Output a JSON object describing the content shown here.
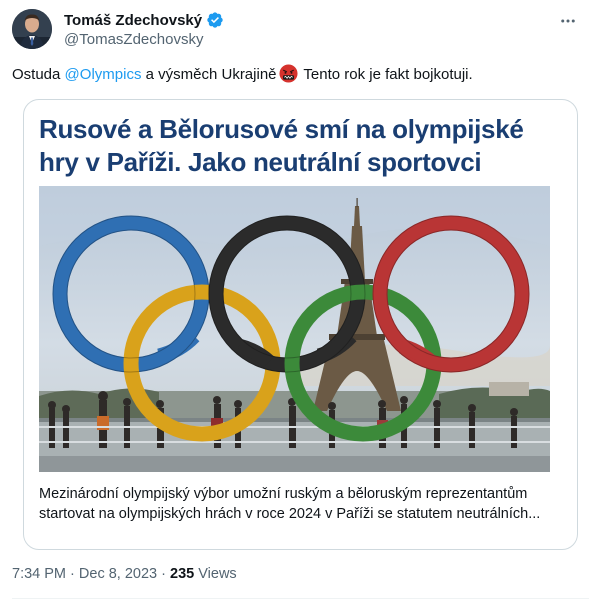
{
  "author": {
    "name": "Tomáš Zdechovský",
    "handle": "@TomasZdechovsky"
  },
  "tweet": {
    "text_before": "Ostuda",
    "mention": "@Olympics",
    "text_middle": "a výsměch Ukrajině",
    "emoji": "face-with-symbols-on-mouth",
    "text_after": "Tento rok je fakt bojkotuji."
  },
  "card": {
    "headline": "Rusové a Bělorusové smí na olympijské hry v Paříži. Jako neutrální sportovci",
    "description": "Mezinárodní olympijský výbor umožní ruským a běloruským reprezentantům startovat na olympijských hrách v roce 2024 v Paříži se statutem neutrálních..."
  },
  "meta": {
    "time": "7:34 PM",
    "separator": "·",
    "date": "Dec 8, 2023",
    "views_count": "235",
    "views_label": "Views"
  },
  "colors": {
    "link": "#1d9bf0",
    "verified": "#1d9bf0",
    "headline": "#1a3e72",
    "ring_blue": "#2f6fb3",
    "ring_yellow": "#d9a21b",
    "ring_black": "#2b2b2b",
    "ring_green": "#3c8a3a",
    "ring_red": "#b93535"
  }
}
